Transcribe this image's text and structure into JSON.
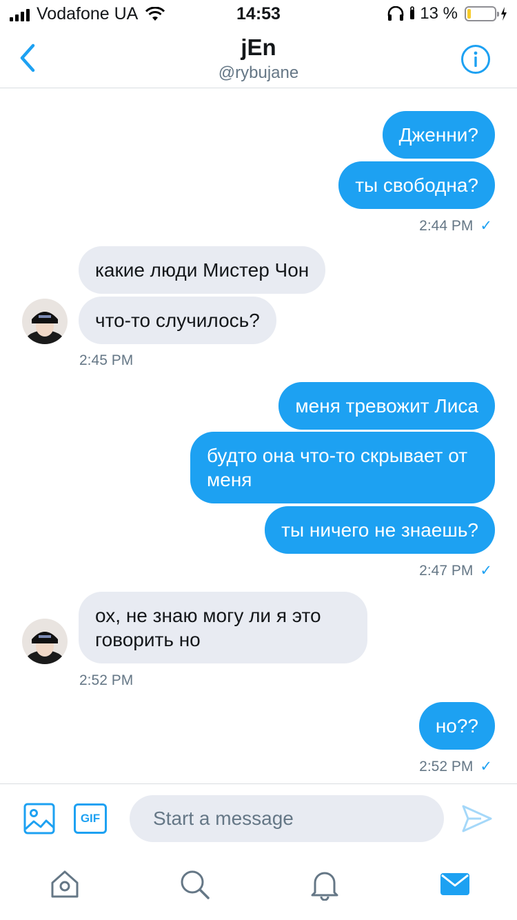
{
  "status_bar": {
    "carrier": "Vodafone UA",
    "time": "14:53",
    "battery_text": "13 %",
    "battery_level": 0.13
  },
  "header": {
    "title": "jEn",
    "handle": "@rybujane"
  },
  "messages": [
    {
      "dir": "out",
      "text": "Дженни?"
    },
    {
      "dir": "out",
      "text": "ты свободна?"
    },
    {
      "dir": "out",
      "time": "2:44 PM",
      "check": "✓"
    },
    {
      "dir": "in",
      "text": "какие люди Мистер Чон"
    },
    {
      "dir": "in",
      "text": "что-то случилось?"
    },
    {
      "dir": "in",
      "time": "2:45 PM"
    },
    {
      "dir": "out",
      "text": "меня тревожит Лиса"
    },
    {
      "dir": "out",
      "text": "будто она что-то скрывает от меня"
    },
    {
      "dir": "out",
      "text": "ты ничего не знаешь?"
    },
    {
      "dir": "out",
      "time": "2:47 PM",
      "check": "✓"
    },
    {
      "dir": "in",
      "text": "ох, не знаю могу ли я это говорить но"
    },
    {
      "dir": "in",
      "time": "2:52 PM"
    },
    {
      "dir": "out",
      "text": "но??"
    },
    {
      "dir": "out",
      "time": "2:52 PM",
      "check": "✓"
    }
  ],
  "composer": {
    "placeholder": "Start a message",
    "gif_label": "GIF"
  },
  "tabs": [
    "home-icon",
    "search-icon",
    "notifications-icon",
    "messages-icon"
  ],
  "colors": {
    "accent": "#1da1f2",
    "incoming_bubble": "#e8ebf2",
    "secondary_text": "#657786"
  }
}
